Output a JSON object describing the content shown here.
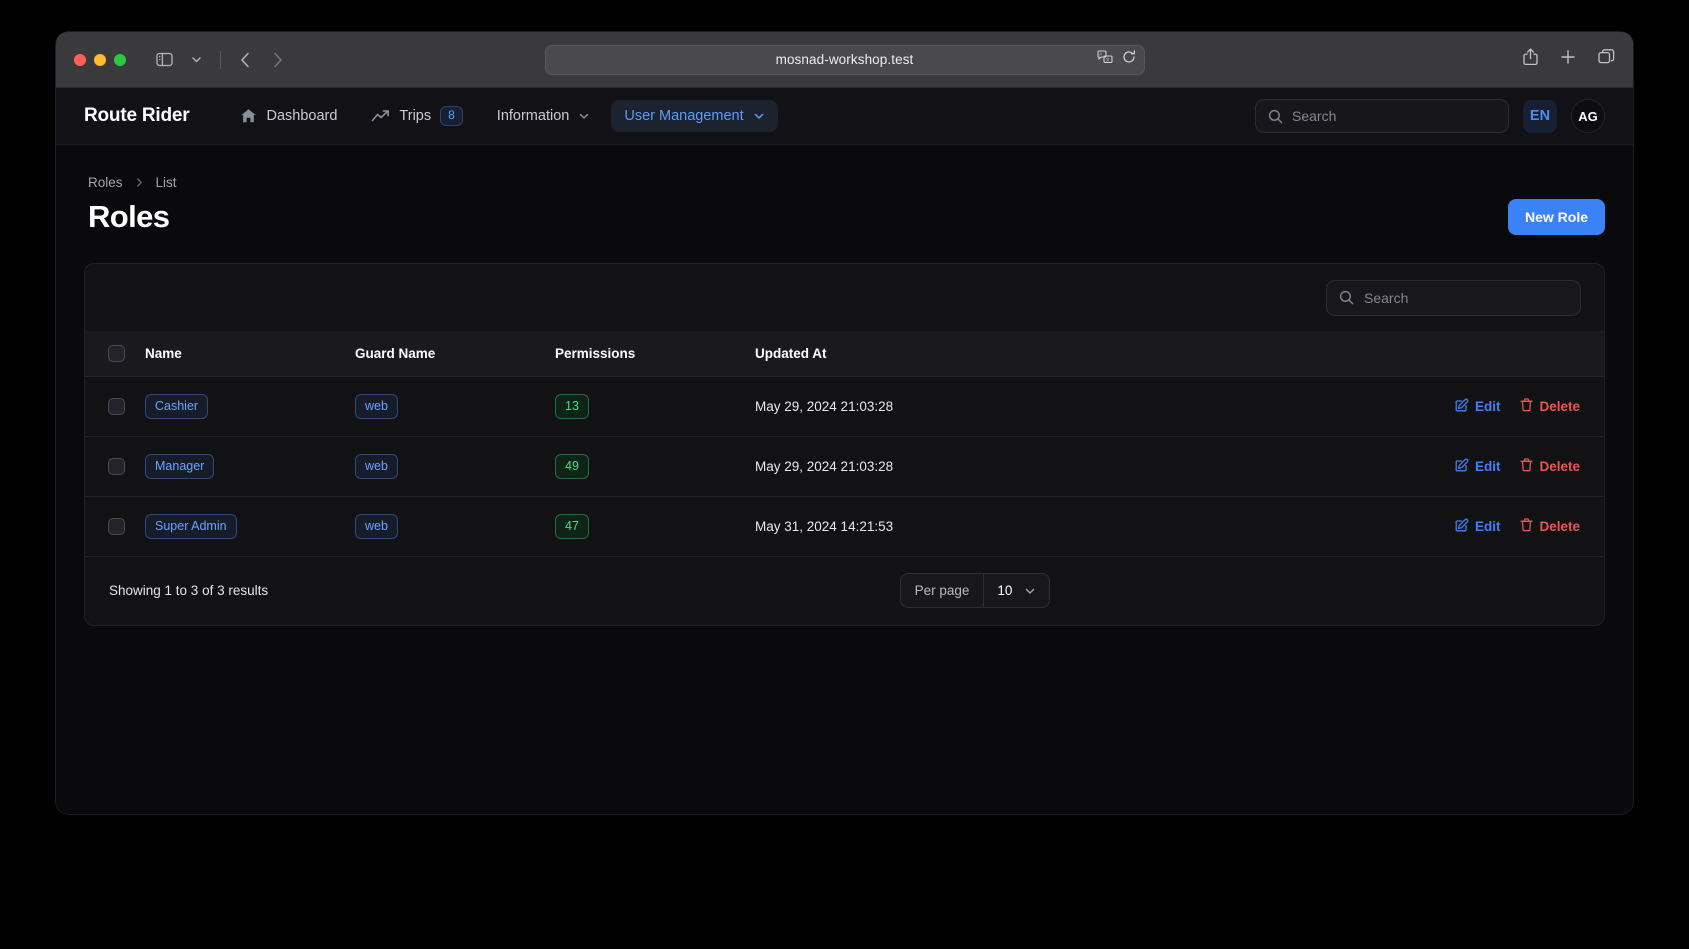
{
  "browser": {
    "url": "mosnad-workshop.test",
    "icons": {
      "sidebar": "sidebar-icon",
      "sidebar_chevron": "chevron-down-icon",
      "back": "back-chevron-icon",
      "forward": "forward-chevron-icon",
      "translate": "translate-icon",
      "reload": "reload-icon",
      "share": "share-icon",
      "new_tab": "plus-icon",
      "tab_overview": "tab-overview-icon"
    }
  },
  "nav": {
    "brand": "Route Rider",
    "items": [
      {
        "label": "Dashboard",
        "icon": "home-icon",
        "badge": null,
        "chevron": false,
        "active": false
      },
      {
        "label": "Trips",
        "icon": "trending-up-icon",
        "badge": "8",
        "chevron": false,
        "active": false
      },
      {
        "label": "Information",
        "icon": null,
        "badge": null,
        "chevron": true,
        "active": false
      },
      {
        "label": "User Management",
        "icon": null,
        "badge": null,
        "chevron": true,
        "active": true
      }
    ],
    "search_placeholder": "Search",
    "search_value": "",
    "language": "EN",
    "avatar_initials": "AG"
  },
  "breadcrumb": {
    "items": [
      "Roles",
      "List"
    ],
    "separator": "chevron-right-icon"
  },
  "page": {
    "title": "Roles",
    "new_button": "New Role"
  },
  "card": {
    "search_placeholder": "Search",
    "search_value": "",
    "columns": [
      "Name",
      "Guard Name",
      "Permissions",
      "Updated At"
    ],
    "rows": [
      {
        "name": "Cashier",
        "guard": "web",
        "permissions": "13",
        "updated_at": "May 29, 2024 21:03:28",
        "edit": "Edit",
        "delete": "Delete"
      },
      {
        "name": "Manager",
        "guard": "web",
        "permissions": "49",
        "updated_at": "May 29, 2024 21:03:28",
        "edit": "Edit",
        "delete": "Delete"
      },
      {
        "name": "Super Admin",
        "guard": "web",
        "permissions": "47",
        "updated_at": "May 31, 2024 14:21:53",
        "edit": "Edit",
        "delete": "Delete"
      }
    ],
    "footer": {
      "results_text": "Showing 1 to 3 of 3 results",
      "per_page_label": "Per page",
      "per_page_value": "10"
    }
  },
  "colors": {
    "accent_blue": "#3b82f6",
    "link_blue": "#5e9bfb",
    "danger_red": "#f05252",
    "badge_green": "#4ade80",
    "page_bg": "#0a0a0c",
    "card_bg": "#121215"
  }
}
